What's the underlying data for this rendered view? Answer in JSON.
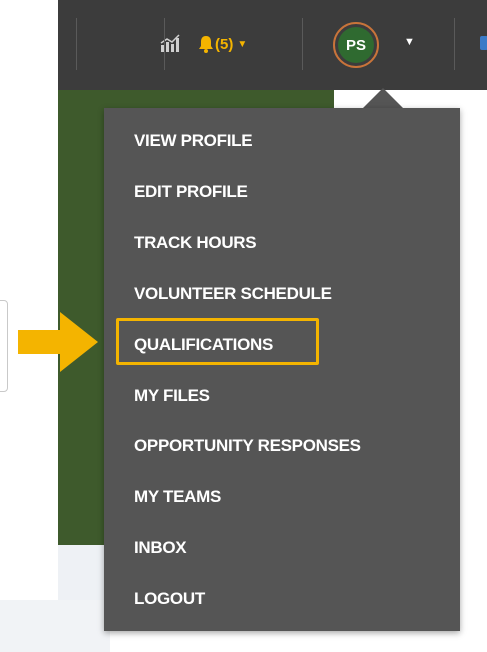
{
  "navbar": {
    "stats_icon": "stats-chart-icon",
    "bell_icon": "bell-icon",
    "notifications_label": "(5)",
    "avatar_initials": "PS"
  },
  "colors": {
    "navbar_bg": "#3c3c3c",
    "accent": "#f4b400",
    "avatar_bg": "#2f6a30",
    "avatar_ring": "#c8743a",
    "menu_bg": "#555555",
    "panel_green": "#3e5a2c"
  },
  "menu": {
    "items": [
      {
        "label": "VIEW PROFILE"
      },
      {
        "label": "EDIT PROFILE"
      },
      {
        "label": "TRACK HOURS"
      },
      {
        "label": "VOLUNTEER SCHEDULE"
      },
      {
        "label": "QUALIFICATIONS",
        "highlighted": true
      },
      {
        "label": "MY FILES"
      },
      {
        "label": "OPPORTUNITY RESPONSES"
      },
      {
        "label": "MY TEAMS"
      },
      {
        "label": "INBOX"
      },
      {
        "label": "LOGOUT"
      }
    ]
  },
  "callout_icon": "arrow-right-icon"
}
